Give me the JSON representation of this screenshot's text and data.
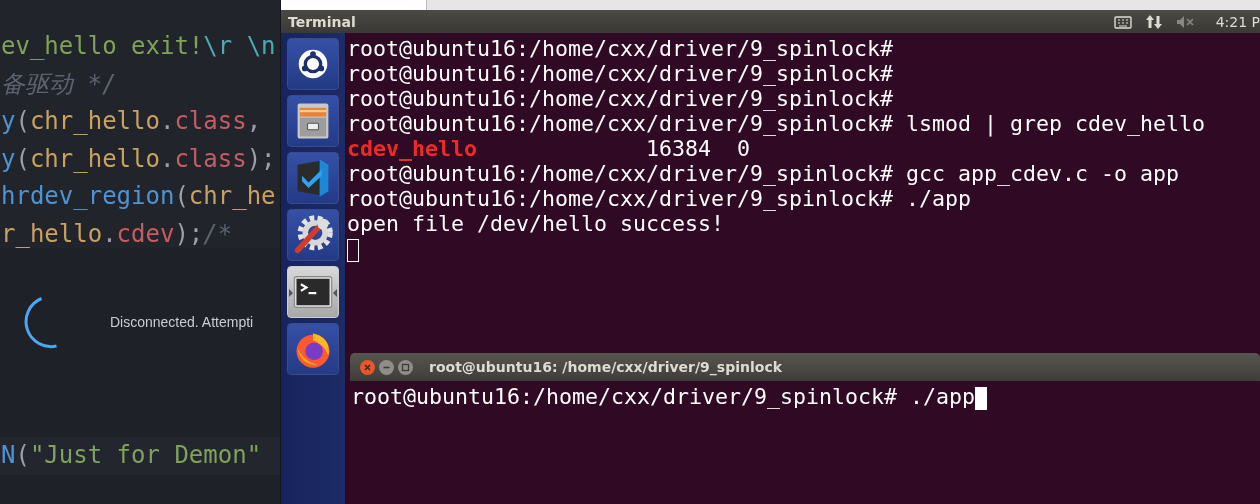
{
  "editor": {
    "code_lines": [
      [
        {
          "kind": "string",
          "text": "ev_hello exit!"
        },
        {
          "kind": "escape",
          "text": "\\r \\n"
        }
      ],
      [
        {
          "kind": "comment",
          "text": "备驱动 */"
        }
      ],
      [
        {
          "kind": "function",
          "text": "y"
        },
        {
          "kind": "punct",
          "text": "("
        },
        {
          "kind": "variable",
          "text": "chr_hello"
        },
        {
          "kind": "punct",
          "text": "."
        },
        {
          "kind": "property",
          "text": "class"
        },
        {
          "kind": "punct",
          "text": ","
        }
      ],
      [
        {
          "kind": "function",
          "text": "y"
        },
        {
          "kind": "punct",
          "text": "("
        },
        {
          "kind": "variable",
          "text": "chr_hello"
        },
        {
          "kind": "punct",
          "text": "."
        },
        {
          "kind": "property",
          "text": "class"
        },
        {
          "kind": "punct",
          "text": ");"
        }
      ],
      [
        {
          "kind": "function",
          "text": "hrdev_region"
        },
        {
          "kind": "punct",
          "text": "("
        },
        {
          "kind": "variable",
          "text": "chr_he"
        }
      ],
      [
        {
          "kind": "variable",
          "text": "r_hello"
        },
        {
          "kind": "punct",
          "text": "."
        },
        {
          "kind": "property",
          "text": "cdev"
        },
        {
          "kind": "punct",
          "text": ");"
        },
        {
          "kind": "comment",
          "text": "/*"
        }
      ]
    ],
    "status_message": "Disconnected. Attempti",
    "bottom_line": [
      {
        "kind": "function",
        "text": "N"
      },
      {
        "kind": "punct",
        "text": "("
      },
      {
        "kind": "string",
        "text": "\"Just for Demon\""
      }
    ]
  },
  "top_panel": {
    "app_title": "Terminal",
    "clock": "4:21 P"
  },
  "launcher": [
    {
      "kind": "ubuntu",
      "selected": false
    },
    {
      "kind": "files",
      "selected": false
    },
    {
      "kind": "code",
      "selected": false
    },
    {
      "kind": "settings",
      "selected": false
    },
    {
      "kind": "terminal",
      "selected": true
    },
    {
      "kind": "browser",
      "selected": false
    }
  ],
  "terminal": {
    "focused": false,
    "lines": [
      [
        {
          "kind": "plain",
          "text": "root@ubuntu16:/home/cxx/driver/9_spinlock#"
        }
      ],
      [
        {
          "kind": "plain",
          "text": "root@ubuntu16:/home/cxx/driver/9_spinlock#"
        }
      ],
      [
        {
          "kind": "plain",
          "text": "root@ubuntu16:/home/cxx/driver/9_spinlock#"
        }
      ],
      [
        {
          "kind": "plain",
          "text": "root@ubuntu16:/home/cxx/driver/9_spinlock# lsmod | grep cdev_hello"
        }
      ],
      [
        {
          "kind": "match",
          "text": "cdev_hello"
        },
        {
          "kind": "plain",
          "text": "             16384  0"
        }
      ],
      [
        {
          "kind": "plain",
          "text": "root@ubuntu16:/home/cxx/driver/9_spinlock# gcc app_cdev.c -o app"
        }
      ],
      [
        {
          "kind": "plain",
          "text": "root@ubuntu16:/home/cxx/driver/9_spinlock# ./app"
        }
      ],
      [
        {
          "kind": "plain",
          "text": "open file /dev/hello success!"
        }
      ]
    ]
  },
  "terminal_window": {
    "title": "root@ubuntu16: /home/cxx/driver/9_spinlock",
    "focused": true,
    "lines": [
      [
        {
          "kind": "plain",
          "text": "root@ubuntu16:/home/cxx/driver/9_spinlock# ./app"
        }
      ]
    ]
  }
}
